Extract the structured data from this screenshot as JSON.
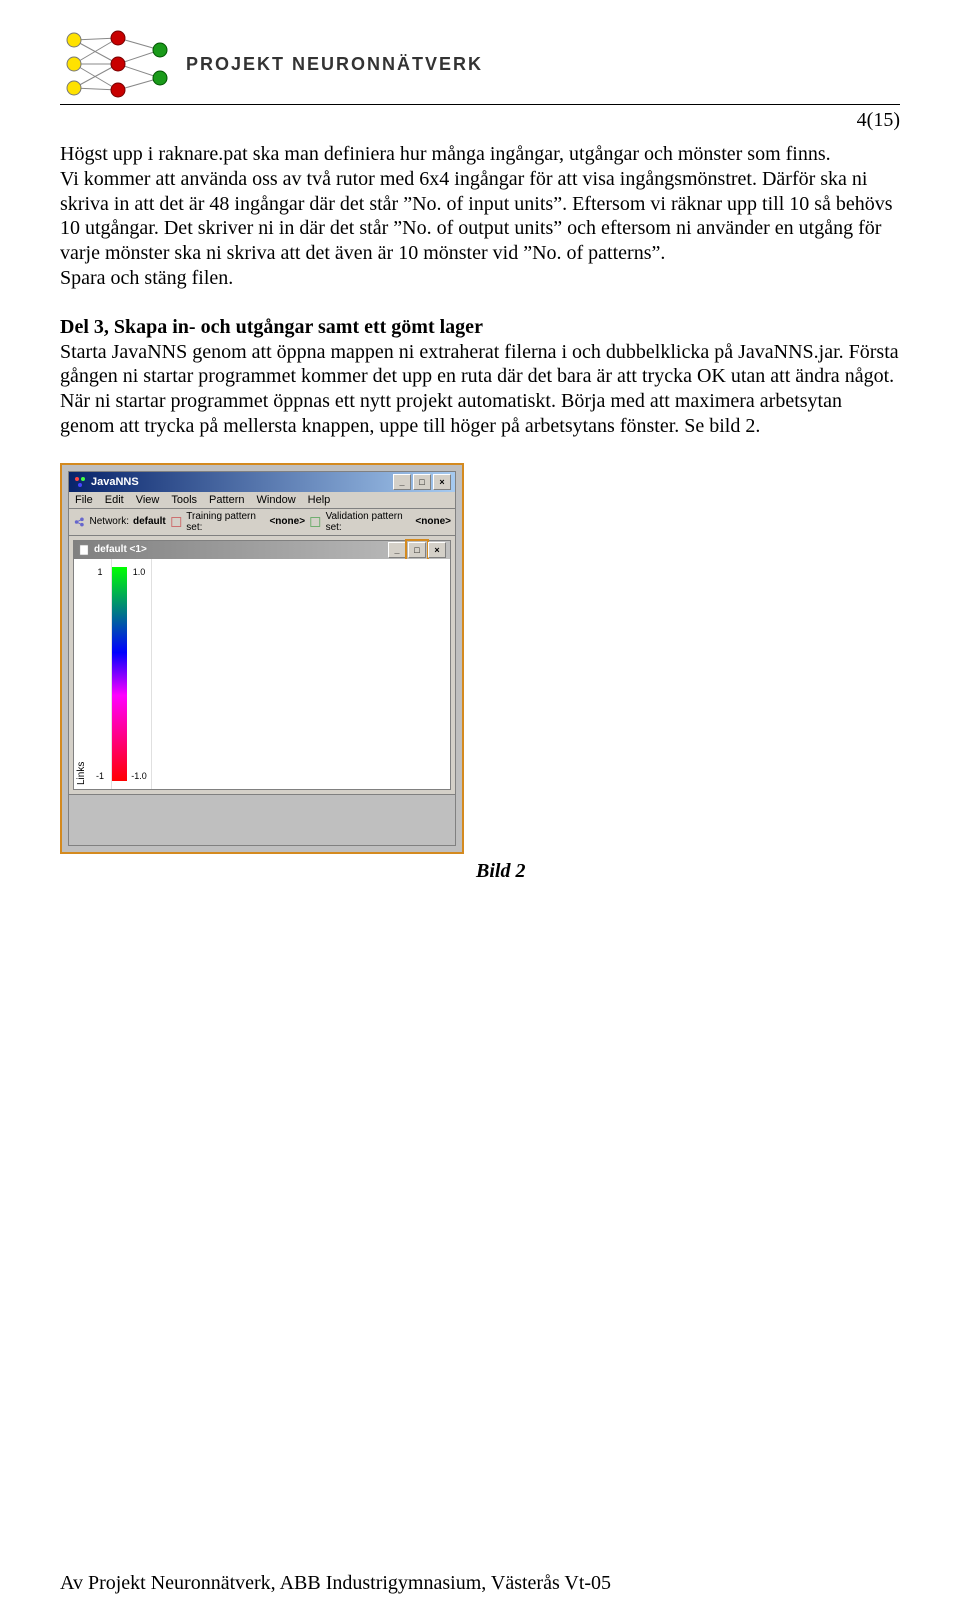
{
  "header": {
    "brand": "PROJEKT NEURONNÄTVERK"
  },
  "pagenum": "4(15)",
  "para1": "Högst upp i raknare.pat ska man definiera hur många ingångar, utgångar och mönster som finns.\nVi kommer att använda oss av två rutor med 6x4 ingångar för att visa ingångsmönstret. Därför ska ni skriva in att det är 48 ingångar där det står ”No. of input units”. Eftersom vi räknar upp till 10 så behövs 10 utgångar. Det skriver ni in där det står ”No. of output units” och eftersom ni använder en utgång för varje mönster ska ni skriva att det även är 10 mönster vid ”No. of patterns”.\nSpara och stäng filen.",
  "section_title": "Del 3, Skapa in- och utgångar samt ett gömt lager",
  "para2": "Starta JavaNNS genom att öppna mappen ni extraherat filerna i och dubbelklicka på JavaNNS.jar. Första gången ni startar programmet kommer det upp en ruta där det bara är att trycka OK utan att ändra något.\nNär ni startar programmet öppnas ett nytt projekt automatiskt. Börja med att maximera arbetsytan genom att trycka på mellersta knappen, uppe till höger på arbetsytans fönster. Se bild 2.",
  "screenshot": {
    "title": "JavaNNS",
    "menus": [
      "File",
      "Edit",
      "View",
      "Tools",
      "Pattern",
      "Window",
      "Help"
    ],
    "toolbar": {
      "network_label": "Network:",
      "network_value": "default",
      "training_label": "Training pattern set:",
      "training_value": "<none>",
      "validation_label": "Validation pattern set:",
      "validation_value": "<none>"
    },
    "inner_title": "default <1>",
    "ruler": {
      "top": "1",
      "bottom": "-1",
      "rtop": "1.0",
      "rbottom": "-1.0"
    },
    "vert_label": "Links"
  },
  "caption": "Bild 2",
  "footer": "Av Projekt Neuronnätverk, ABB Industrigymnasium, Västerås Vt-05"
}
